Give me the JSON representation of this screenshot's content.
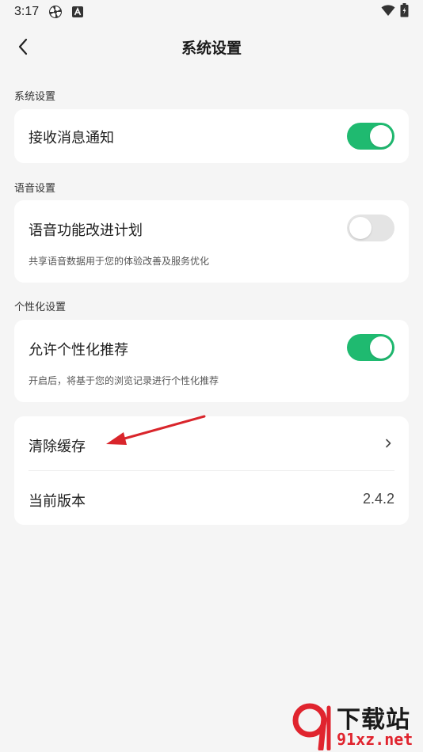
{
  "status_bar": {
    "time": "3:17",
    "icons": [
      "pinwheel-icon",
      "a-letter-icon",
      "wifi-icon",
      "battery-icon"
    ]
  },
  "header": {
    "title": "系统设置",
    "back_icon": "chevron-left-icon"
  },
  "sections": {
    "system": {
      "label": "系统设置",
      "rows": [
        {
          "title": "接收消息通知",
          "toggle": "on"
        }
      ]
    },
    "voice": {
      "label": "语音设置",
      "rows": [
        {
          "title": "语音功能改进计划",
          "description": "共享语音数据用于您的体验改善及服务优化",
          "toggle": "off"
        }
      ]
    },
    "personal": {
      "label": "个性化设置",
      "rows": [
        {
          "title": "允许个性化推荐",
          "description": "开启后，将基于您的浏览记录进行个性化推荐",
          "toggle": "on"
        }
      ]
    },
    "other": {
      "rows": [
        {
          "title": "清除缓存",
          "icon": "chevron-right-icon"
        },
        {
          "title": "当前版本",
          "value": "2.4.2"
        }
      ]
    }
  },
  "watermark": {
    "line1": "下载站",
    "line2": "91xz.net"
  },
  "colors": {
    "accent": "#1fba70",
    "toggle_off": "#e4e4e4",
    "background": "#f5f5f5",
    "card": "#ffffff",
    "annotation_arrow": "#d9252b"
  }
}
